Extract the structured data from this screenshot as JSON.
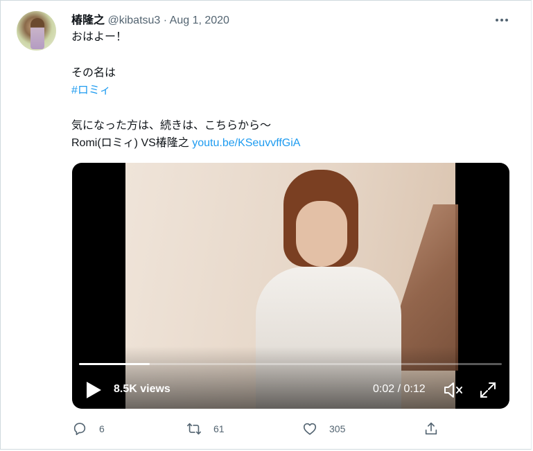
{
  "tweet": {
    "author_name": "椿隆之",
    "handle": "@kibatsu3",
    "separator": " · ",
    "date": "Aug 1, 2020",
    "lines": {
      "greeting": "おはよー！",
      "name_intro": "その名は",
      "hashtag": "#ロミィ",
      "continue": "気になった方は、続きは、こちらから～",
      "video_title": "Romi(ロミィ) VS椿隆之 ",
      "link": "youtu.be/KSeuvvffGiA"
    }
  },
  "video": {
    "views": "8.5K views",
    "time": "0:02 / 0:12",
    "progress": 0.167
  },
  "actions": {
    "replies": "6",
    "retweets": "61",
    "likes": "305"
  },
  "icons": [
    "avatar",
    "more-icon",
    "play-icon",
    "mute-icon",
    "expand-icon",
    "reply-icon",
    "retweet-icon",
    "like-icon",
    "share-icon"
  ],
  "colors": {
    "link": "#1d9bf0",
    "secondary": "#536471",
    "text": "#0f1419"
  }
}
